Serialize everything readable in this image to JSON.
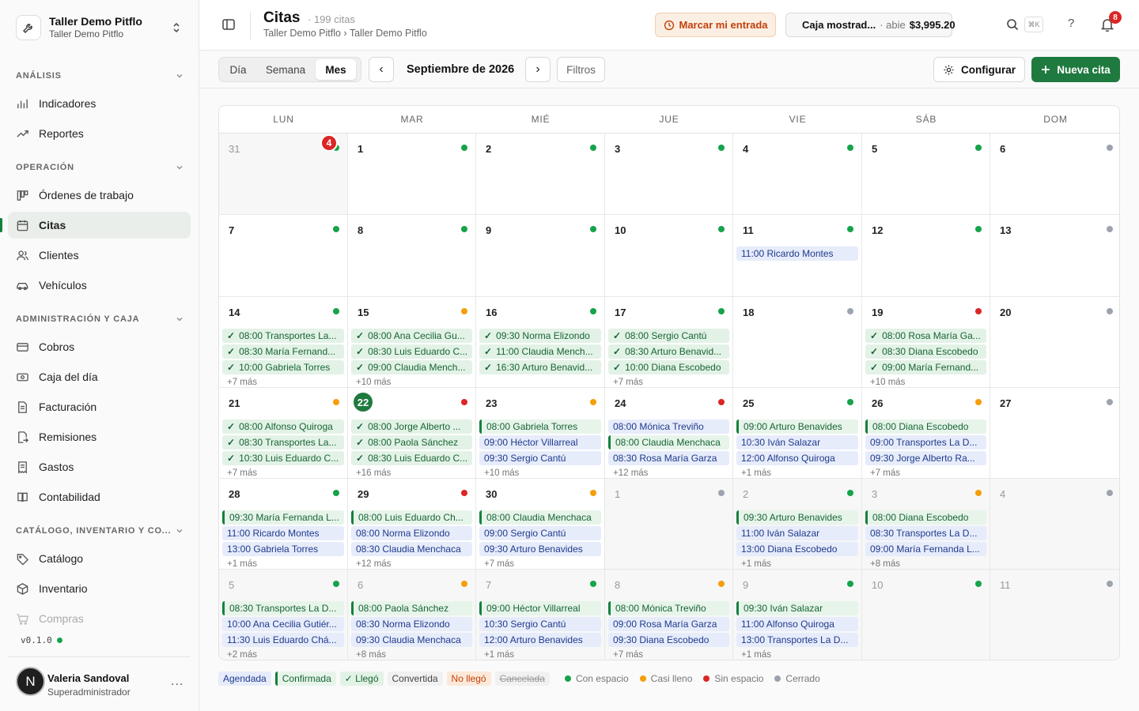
{
  "workspace": {
    "name": "Taller Demo Pitflo",
    "sub": "Taller Demo Pitflo"
  },
  "sidebar": {
    "sections": [
      {
        "title": "ANÁLISIS",
        "items": [
          {
            "label": "Indicadores",
            "icon": "bar-chart-icon"
          },
          {
            "label": "Reportes",
            "icon": "trending-icon"
          }
        ]
      },
      {
        "title": "OPERACIÓN",
        "items": [
          {
            "label": "Órdenes de trabajo",
            "icon": "kanban-icon"
          },
          {
            "label": "Citas",
            "icon": "calendar-icon",
            "active": true
          },
          {
            "label": "Clientes",
            "icon": "users-icon"
          },
          {
            "label": "Vehículos",
            "icon": "car-icon"
          }
        ]
      },
      {
        "title": "ADMINISTRACIÓN Y CAJA",
        "items": [
          {
            "label": "Cobros",
            "icon": "credit-card-icon"
          },
          {
            "label": "Caja del día",
            "icon": "cash-icon"
          },
          {
            "label": "Facturación",
            "icon": "file-icon"
          },
          {
            "label": "Remisiones",
            "icon": "file-export-icon"
          },
          {
            "label": "Gastos",
            "icon": "receipt-icon"
          },
          {
            "label": "Contabilidad",
            "icon": "book-icon"
          }
        ]
      },
      {
        "title": "CATÁLOGO, INVENTARIO Y CO...",
        "items": [
          {
            "label": "Catálogo",
            "icon": "tag-icon"
          },
          {
            "label": "Inventario",
            "icon": "box-icon"
          },
          {
            "label": "Compras",
            "icon": "cart-icon",
            "faded": true
          }
        ]
      }
    ],
    "version": "v0.1.0",
    "user": {
      "initial": "N",
      "name": "Valeria Sandoval",
      "role": "Superadministrador",
      "more": "..."
    }
  },
  "header": {
    "title": "Citas",
    "count": "· 199 citas",
    "breadcrumb": "Taller Demo Pitflo › Taller Demo Pitflo",
    "entrada_label": "Marcar mi entrada",
    "caja": {
      "name": "Caja mostrad...",
      "status": "· abie",
      "amount": "$3,995.20"
    },
    "kbd": "⌘K",
    "help": "?",
    "notifications": "8"
  },
  "toolbar": {
    "views": [
      "Día",
      "Semana",
      "Mes"
    ],
    "active_view": "Mes",
    "prev": "‹",
    "next": "›",
    "month": "Septiembre de 2026",
    "filtros": "Filtros",
    "configurar": "Configurar",
    "nueva": "Nueva cita"
  },
  "calendar": {
    "weekdays": [
      "LUN",
      "MAR",
      "MIÉ",
      "JUE",
      "VIE",
      "SÁB",
      "DOM"
    ],
    "overflow_badge": "4",
    "colors": {
      "con": "#16a34a",
      "casi": "#f59e0b",
      "sin": "#dc2626",
      "cerrado": "#9ca3af"
    },
    "weeks": [
      [
        {
          "d": "31",
          "other": true,
          "dot": "con",
          "events": [],
          "more": ""
        },
        {
          "d": "1",
          "dot": "con",
          "events": [],
          "more": ""
        },
        {
          "d": "2",
          "dot": "con",
          "events": [],
          "more": ""
        },
        {
          "d": "3",
          "dot": "con",
          "events": [],
          "more": ""
        },
        {
          "d": "4",
          "dot": "con",
          "events": [],
          "more": ""
        },
        {
          "d": "5",
          "dot": "con",
          "events": [],
          "more": ""
        },
        {
          "d": "6",
          "dot": "cerrado",
          "events": [],
          "more": ""
        }
      ],
      [
        {
          "d": "7",
          "dot": "con",
          "events": [],
          "more": ""
        },
        {
          "d": "8",
          "dot": "con",
          "events": [],
          "more": ""
        },
        {
          "d": "9",
          "dot": "con",
          "events": [],
          "more": ""
        },
        {
          "d": "10",
          "dot": "con",
          "events": [],
          "more": ""
        },
        {
          "d": "11",
          "dot": "con",
          "events": [
            {
              "t": "11:00 Ricardo Montes",
              "s": "agendada"
            }
          ],
          "more": ""
        },
        {
          "d": "12",
          "dot": "con",
          "events": [],
          "more": ""
        },
        {
          "d": "13",
          "dot": "cerrado",
          "events": [],
          "more": ""
        }
      ],
      [
        {
          "d": "14",
          "dot": "con",
          "events": [
            {
              "t": "08:00 Transportes La...",
              "s": "llego"
            },
            {
              "t": "08:30 María Fernand...",
              "s": "llego"
            },
            {
              "t": "10:00 Gabriela Torres",
              "s": "llego"
            }
          ],
          "more": "+7 más"
        },
        {
          "d": "15",
          "dot": "casi",
          "events": [
            {
              "t": "08:00 Ana Cecilia Gu...",
              "s": "llego"
            },
            {
              "t": "08:30 Luis Eduardo C...",
              "s": "llego"
            },
            {
              "t": "09:00 Claudia Mench...",
              "s": "llego"
            }
          ],
          "more": "+10 más"
        },
        {
          "d": "16",
          "dot": "con",
          "events": [
            {
              "t": "09:30 Norma Elizondo",
              "s": "llego"
            },
            {
              "t": "11:00 Claudia Mench...",
              "s": "llego"
            },
            {
              "t": "16:30 Arturo Benavid...",
              "s": "llego"
            }
          ],
          "more": ""
        },
        {
          "d": "17",
          "dot": "con",
          "events": [
            {
              "t": "08:00 Sergio Cantú",
              "s": "llego"
            },
            {
              "t": "08:30 Arturo Benavid...",
              "s": "llego"
            },
            {
              "t": "10:00 Diana Escobedo",
              "s": "llego"
            }
          ],
          "more": "+7 más"
        },
        {
          "d": "18",
          "dot": "cerrado",
          "events": [],
          "more": ""
        },
        {
          "d": "19",
          "dot": "sin",
          "events": [
            {
              "t": "08:00 Rosa María Ga...",
              "s": "llego"
            },
            {
              "t": "08:30 Diana Escobedo",
              "s": "llego"
            },
            {
              "t": "09:00 María Fernand...",
              "s": "llego"
            }
          ],
          "more": "+10 más"
        },
        {
          "d": "20",
          "dot": "cerrado",
          "events": [],
          "more": ""
        }
      ],
      [
        {
          "d": "21",
          "dot": "casi",
          "events": [
            {
              "t": "08:00 Alfonso Quiroga",
              "s": "llego"
            },
            {
              "t": "08:30 Transportes La...",
              "s": "llego"
            },
            {
              "t": "10:30 Luis Eduardo C...",
              "s": "llego"
            }
          ],
          "more": "+7 más"
        },
        {
          "d": "22",
          "today": true,
          "dot": "sin",
          "events": [
            {
              "t": "08:00 Jorge Alberto ...",
              "s": "llego"
            },
            {
              "t": "08:00 Paola Sánchez",
              "s": "llego"
            },
            {
              "t": "08:30 Luis Eduardo C...",
              "s": "llego"
            }
          ],
          "more": "+16 más"
        },
        {
          "d": "23",
          "dot": "casi",
          "events": [
            {
              "t": "08:00 Gabriela Torres",
              "s": "confirmada"
            },
            {
              "t": "09:00 Héctor Villarreal",
              "s": "agendada"
            },
            {
              "t": "09:30 Sergio Cantú",
              "s": "agendada"
            }
          ],
          "more": "+10 más"
        },
        {
          "d": "24",
          "dot": "sin",
          "events": [
            {
              "t": "08:00 Mónica Treviño",
              "s": "agendada"
            },
            {
              "t": "08:00 Claudia Menchaca",
              "s": "confirmada"
            },
            {
              "t": "08:30 Rosa María Garza",
              "s": "agendada"
            }
          ],
          "more": "+12 más"
        },
        {
          "d": "25",
          "dot": "con",
          "events": [
            {
              "t": "09:00 Arturo Benavides",
              "s": "confirmada"
            },
            {
              "t": "10:30 Iván Salazar",
              "s": "agendada"
            },
            {
              "t": "12:00 Alfonso Quiroga",
              "s": "agendada"
            }
          ],
          "more": "+1 más"
        },
        {
          "d": "26",
          "dot": "casi",
          "events": [
            {
              "t": "08:00 Diana Escobedo",
              "s": "confirmada"
            },
            {
              "t": "09:00 Transportes La D...",
              "s": "agendada"
            },
            {
              "t": "09:30 Jorge Alberto Ra...",
              "s": "agendada"
            }
          ],
          "more": "+7 más"
        },
        {
          "d": "27",
          "dot": "cerrado",
          "events": [],
          "more": ""
        }
      ],
      [
        {
          "d": "28",
          "dot": "con",
          "events": [
            {
              "t": "09:30 María Fernanda L...",
              "s": "confirmada"
            },
            {
              "t": "11:00 Ricardo Montes",
              "s": "agendada"
            },
            {
              "t": "13:00 Gabriela Torres",
              "s": "agendada"
            }
          ],
          "more": "+1 más"
        },
        {
          "d": "29",
          "dot": "sin",
          "events": [
            {
              "t": "08:00 Luis Eduardo Ch...",
              "s": "confirmada"
            },
            {
              "t": "08:00 Norma Elizondo",
              "s": "agendada"
            },
            {
              "t": "08:30 Claudia Menchaca",
              "s": "agendada"
            }
          ],
          "more": "+12 más"
        },
        {
          "d": "30",
          "dot": "casi",
          "events": [
            {
              "t": "08:00 Claudia Menchaca",
              "s": "confirmada"
            },
            {
              "t": "09:00 Sergio Cantú",
              "s": "agendada"
            },
            {
              "t": "09:30 Arturo Benavides",
              "s": "agendada"
            }
          ],
          "more": "+7 más"
        },
        {
          "d": "1",
          "other": true,
          "dot": "cerrado",
          "events": [],
          "more": ""
        },
        {
          "d": "2",
          "other": true,
          "dot": "con",
          "events": [
            {
              "t": "09:30 Arturo Benavides",
              "s": "confirmada"
            },
            {
              "t": "11:00 Iván Salazar",
              "s": "agendada"
            },
            {
              "t": "13:00 Diana Escobedo",
              "s": "agendada"
            }
          ],
          "more": "+1 más"
        },
        {
          "d": "3",
          "other": true,
          "dot": "casi",
          "events": [
            {
              "t": "08:00 Diana Escobedo",
              "s": "confirmada"
            },
            {
              "t": "08:30 Transportes La D...",
              "s": "agendada"
            },
            {
              "t": "09:00 María Fernanda L...",
              "s": "agendada"
            }
          ],
          "more": "+8 más"
        },
        {
          "d": "4",
          "other": true,
          "dot": "cerrado",
          "events": [],
          "more": ""
        }
      ],
      [
        {
          "d": "5",
          "other": true,
          "dot": "con",
          "events": [
            {
              "t": "08:30 Transportes La D...",
              "s": "confirmada"
            },
            {
              "t": "10:00 Ana Cecilia Gutiér...",
              "s": "agendada"
            },
            {
              "t": "11:30 Luis Eduardo Chá...",
              "s": "agendada"
            }
          ],
          "more": "+2 más"
        },
        {
          "d": "6",
          "other": true,
          "dot": "casi",
          "events": [
            {
              "t": "08:00 Paola Sánchez",
              "s": "confirmada"
            },
            {
              "t": "08:30 Norma Elizondo",
              "s": "agendada"
            },
            {
              "t": "09:30 Claudia Menchaca",
              "s": "agendada"
            }
          ],
          "more": "+8 más"
        },
        {
          "d": "7",
          "other": true,
          "dot": "con",
          "events": [
            {
              "t": "09:00 Héctor Villarreal",
              "s": "confirmada"
            },
            {
              "t": "10:30 Sergio Cantú",
              "s": "agendada"
            },
            {
              "t": "12:00 Arturo Benavides",
              "s": "agendada"
            }
          ],
          "more": "+1 más"
        },
        {
          "d": "8",
          "other": true,
          "dot": "casi",
          "events": [
            {
              "t": "08:00 Mónica Treviño",
              "s": "confirmada"
            },
            {
              "t": "09:00 Rosa María Garza",
              "s": "agendada"
            },
            {
              "t": "09:30 Diana Escobedo",
              "s": "agendada"
            }
          ],
          "more": "+7 más"
        },
        {
          "d": "9",
          "other": true,
          "dot": "con",
          "events": [
            {
              "t": "09:30 Iván Salazar",
              "s": "confirmada"
            },
            {
              "t": "11:00 Alfonso Quiroga",
              "s": "agendada"
            },
            {
              "t": "13:00 Transportes La D...",
              "s": "agendada"
            }
          ],
          "more": "+1 más"
        },
        {
          "d": "10",
          "other": true,
          "dot": "con",
          "events": [],
          "more": ""
        },
        {
          "d": "11",
          "other": true,
          "dot": "cerrado",
          "events": [],
          "more": ""
        }
      ]
    ]
  },
  "legend": {
    "statuses": [
      {
        "label": "Agendada",
        "cls": "a"
      },
      {
        "label": "Confirmada",
        "cls": "c"
      },
      {
        "label": "✓ Llegó",
        "cls": "l"
      },
      {
        "label": "Convertida",
        "cls": "cv"
      },
      {
        "label": "No llegó",
        "cls": "n"
      },
      {
        "label": "Cancelada",
        "cls": "x"
      }
    ],
    "capacity": [
      {
        "label": "Con espacio",
        "color": "#16a34a"
      },
      {
        "label": "Casi lleno",
        "color": "#f59e0b"
      },
      {
        "label": "Sin espacio",
        "color": "#dc2626"
      },
      {
        "label": "Cerrado",
        "color": "#9ca3af"
      }
    ]
  }
}
